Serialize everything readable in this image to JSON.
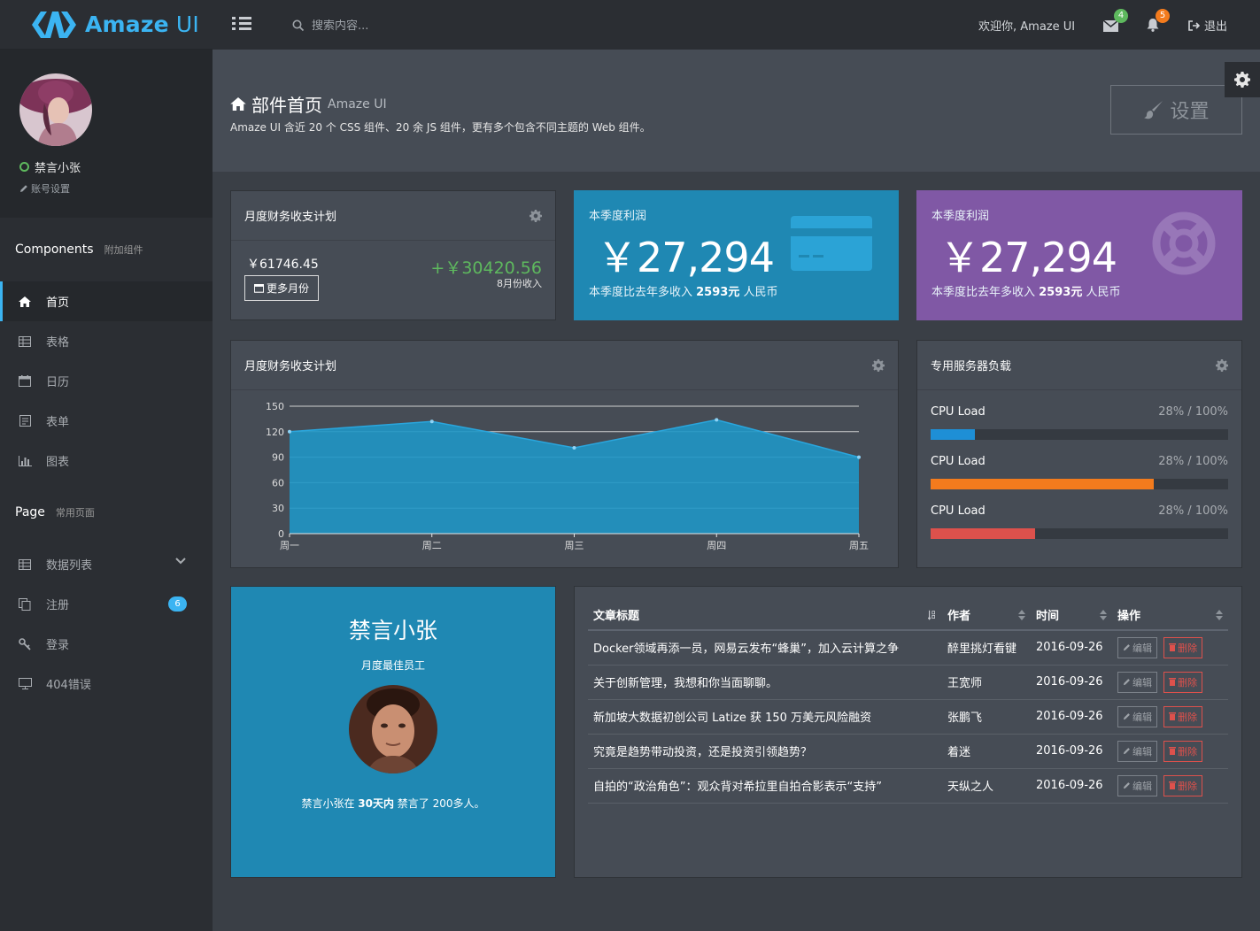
{
  "header": {
    "logo_main": "Amaze",
    "logo_sub": " UI",
    "search_placeholder": "搜索内容...",
    "welcome": "欢迎你, Amaze UI",
    "mail_count": "4",
    "bell_count": "5",
    "logout": "退出"
  },
  "sidebar": {
    "username": "禁言小张",
    "account_settings": "账号设置",
    "components_title": "Components",
    "components_sub": "附加组件",
    "items": [
      {
        "label": "首页"
      },
      {
        "label": "表格"
      },
      {
        "label": "日历"
      },
      {
        "label": "表单"
      },
      {
        "label": "图表"
      }
    ],
    "page_title": "Page",
    "page_sub": "常用页面",
    "page_items": [
      {
        "label": "数据列表"
      },
      {
        "label": "注册",
        "badge": "6"
      },
      {
        "label": "登录"
      },
      {
        "label": "404错误"
      }
    ]
  },
  "page": {
    "title": "部件首页",
    "title_sub": "Amaze UI",
    "description": "Amaze UI 含近 20 个 CSS 组件、20 余 JS 组件，更有多个包含不同主题的 Web 组件。",
    "settings_button": "设置"
  },
  "finance_card": {
    "title": "月度财务收支计划",
    "left_amount": "￥61746.45",
    "more_button": "更多月份",
    "right_amount": "+￥30420.56",
    "right_sub": "8月份收入"
  },
  "stat_cards": [
    {
      "label": "本季度利润",
      "value": "￥27,294",
      "foot_prefix": "本季度比去年多收入 ",
      "foot_value": "2593元",
      "foot_suffix": " 人民币",
      "color": "#1f88b3"
    },
    {
      "label": "本季度利润",
      "value": "￥27,294",
      "foot_prefix": "本季度比去年多收入 ",
      "foot_value": "2593元",
      "foot_suffix": " 人民币",
      "color": "#8058a5"
    }
  ],
  "chart_card": {
    "title": "月度财务收支计划"
  },
  "chart_data": {
    "type": "area",
    "categories": [
      "周一",
      "周二",
      "周三",
      "周四",
      "周五"
    ],
    "values": [
      120,
      132,
      101,
      134,
      90
    ],
    "ylim": [
      0,
      150
    ],
    "yticks": [
      0,
      30,
      60,
      90,
      120,
      150
    ],
    "grid": true,
    "color": "#1f96c5"
  },
  "server_card": {
    "title": "专用服务器负载",
    "rows": [
      {
        "label": "CPU Load",
        "value": "28% / 100%",
        "fill": 0.15,
        "color": "#1e8fd6"
      },
      {
        "label": "CPU Load",
        "value": "28% / 100%",
        "fill": 0.75,
        "color": "#f37b1d"
      },
      {
        "label": "CPU Load",
        "value": "28% / 100%",
        "fill": 0.35,
        "color": "#dd514c"
      }
    ]
  },
  "profile_card": {
    "name": "禁言小张",
    "role": "月度最佳员工",
    "note_prefix": "禁言小张在 ",
    "note_bold": "30天内",
    "note_suffix": " 禁言了 200多人。"
  },
  "articles": {
    "headers": [
      "文章标题",
      "作者",
      "时间",
      "操作"
    ],
    "edit_label": "编辑",
    "delete_label": "删除",
    "rows": [
      {
        "title": "Docker领域再添一员，网易云发布“蜂巢”，加入云计算之争",
        "author": "醉里挑灯看键",
        "date": "2016-09-26"
      },
      {
        "title": "关于创新管理，我想和你当面聊聊。",
        "author": "王宽师",
        "date": "2016-09-26"
      },
      {
        "title": "新加坡大数据初创公司 Latize 获 150 万美元风险融资",
        "author": "张鹏飞",
        "date": "2016-09-26"
      },
      {
        "title": "究竟是趋势带动投资，还是投资引领趋势？",
        "author": "着迷",
        "date": "2016-09-26"
      },
      {
        "title": "自拍的“政治角色”：观众背对希拉里自拍合影表示“支持”",
        "author": "天纵之人",
        "date": "2016-09-26"
      }
    ]
  }
}
